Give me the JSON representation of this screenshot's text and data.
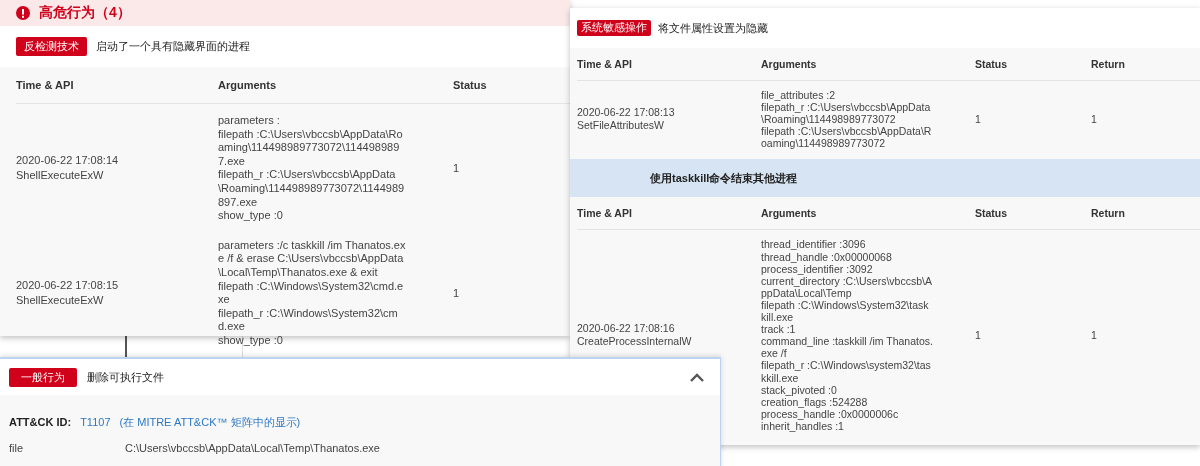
{
  "high_risk_panel": {
    "title": "高危行为（4）",
    "behavior": {
      "tag": "反检测技术",
      "description": "启动了一个具有隐藏界面的进程"
    },
    "table": {
      "columns": [
        "Time & API",
        "Arguments",
        "Status"
      ],
      "rows": [
        {
          "time": "2020-06-22 17:08:14",
          "api": "ShellExecuteExW",
          "arguments": [
            "parameters :",
            "filepath :C:\\Users\\vbccsb\\AppData\\Roaming\\114498989773072\\1144989897.exe",
            "filepath_r :C:\\Users\\vbccsb\\AppData\\Roaming\\114498989773072\\1144989897.exe",
            "show_type :0"
          ],
          "status": "1"
        },
        {
          "time": "2020-06-22 17:08:15",
          "api": "ShellExecuteExW",
          "arguments": [
            "parameters :/c taskkill /im Thanatos.exe /f & erase C:\\Users\\vbccsb\\AppData\\Local\\Temp\\Thanatos.exe & exit",
            "filepath :C:\\Windows\\System32\\cmd.exe",
            "filepath_r :C:\\Windows\\System32\\cmd.exe",
            "show_type :0"
          ],
          "status": "1"
        }
      ]
    }
  },
  "sensitive_panel": {
    "sections": [
      {
        "tag": "系统敏感操作",
        "description": "将文件属性设置为隐藏",
        "highlighted": false,
        "table": {
          "columns": [
            "Time & API",
            "Arguments",
            "Status",
            "Return"
          ],
          "rows": [
            {
              "time": "2020-06-22 17:08:13",
              "api": "SetFileAttributesW",
              "arguments": [
                "file_attributes :2",
                "filepath_r :C:\\Users\\vbccsb\\AppData\\Roaming\\114498989773072",
                "filepath :C:\\Users\\vbccsb\\AppData\\Roaming\\114498989773072"
              ],
              "status": "1",
              "return": "1"
            }
          ]
        }
      },
      {
        "description": "使用taskkill命令结束其他进程",
        "highlighted": true,
        "table": {
          "columns": [
            "Time & API",
            "Arguments",
            "Status",
            "Return"
          ],
          "rows": [
            {
              "time": "2020-06-22 17:08:16",
              "api": "CreateProcessInternalW",
              "arguments": [
                "thread_identifier :3096",
                "thread_handle :0x00000068",
                "process_identifier :3092",
                "current_directory :C:\\Users\\vbccsb\\AppData\\Local\\Temp",
                "filepath :C:\\Windows\\System32\\taskkill.exe",
                "track :1",
                "command_line :taskkill /im Thanatos.exe /f",
                "filepath_r :C:\\Windows\\system32\\taskkill.exe",
                "stack_pivoted :0",
                "creation_flags :524288",
                "process_handle :0x0000006c",
                "inherit_handles :1"
              ],
              "status": "1",
              "return": "1"
            }
          ]
        }
      }
    ]
  },
  "general_panel": {
    "tag": "一般行为",
    "description": "删除可执行文件",
    "expanded": true,
    "attck": {
      "label": "ATT&CK ID:",
      "id": "T1107",
      "matrix_link": "(在 MITRE ATT&CK™ 矩阵中的显示)"
    },
    "fields": [
      {
        "name": "file",
        "value": "C:\\Users\\vbccsb\\AppData\\Local\\Temp\\Thanatos.exe"
      }
    ]
  }
}
